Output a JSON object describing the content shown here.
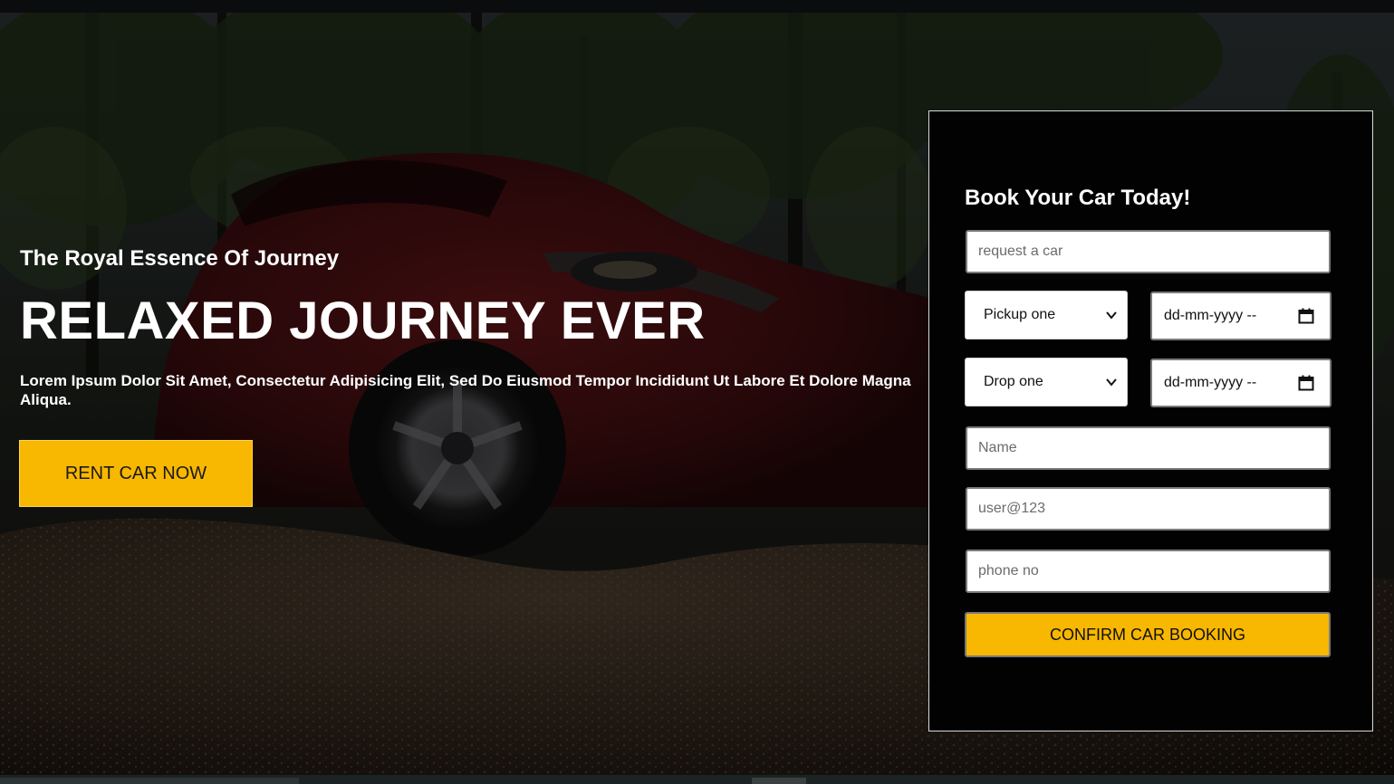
{
  "hero": {
    "tagline": "The Royal Essence Of Journey",
    "headline": "RELAXED JOURNEY EVER",
    "description": "Lorem Ipsum Dolor Sit Amet, Consectetur Adipisicing Elit, Sed Do Eiusmod Tempor Incididunt Ut Labore Et Dolore Magna Aliqua.",
    "cta_label": "RENT CAR NOW",
    "background_icon": "red-sports-car-photo"
  },
  "booking": {
    "title": "Book Your Car Today!",
    "request_placeholder": "request a car",
    "pickup_select": "Pickup one",
    "pickup_date": "dd-mm-yyyy --",
    "drop_select": "Drop one",
    "drop_date": "dd-mm-yyyy --",
    "name_placeholder": "Name",
    "email_placeholder": "user@123",
    "phone_placeholder": "phone no",
    "confirm_label": "CONFIRM CAR BOOKING"
  },
  "colors": {
    "accent": "#f8b700",
    "panel_background": "#020202",
    "text": "#ffffff"
  }
}
